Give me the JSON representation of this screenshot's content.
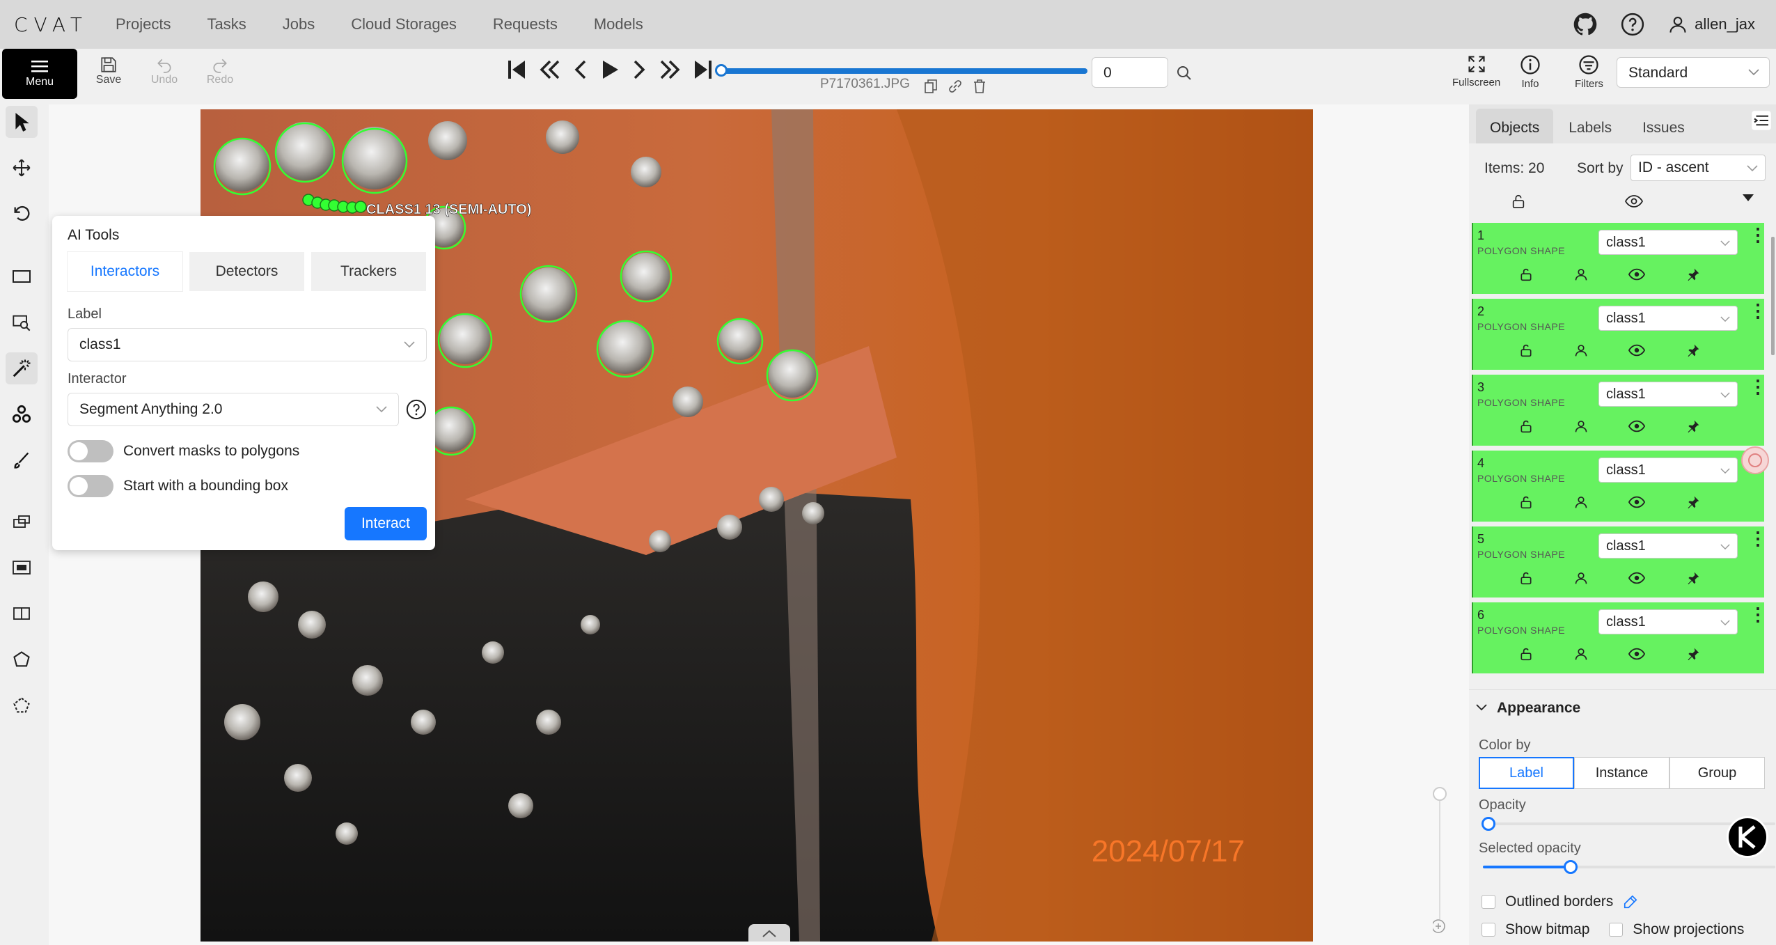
{
  "app": {
    "logo": "CVAT",
    "user": "allen_jax"
  },
  "nav": [
    "Projects",
    "Tasks",
    "Jobs",
    "Cloud Storages",
    "Requests",
    "Models"
  ],
  "toolbar": {
    "menu": "Menu",
    "save": "Save",
    "undo": "Undo",
    "redo": "Redo",
    "frame": "0",
    "filename": "P7170361.JPG",
    "fullscreen": "Fullscreen",
    "info": "Info",
    "filters": "Filters",
    "workspace": "Standard"
  },
  "canvas": {
    "shape_label": "CLASS1 13 (SEMI-AUTO)",
    "timestamp": "2024/07/17"
  },
  "ai_tools": {
    "title": "AI Tools",
    "tabs": [
      "Interactors",
      "Detectors",
      "Trackers"
    ],
    "label_title": "Label",
    "label_value": "class1",
    "interactor_title": "Interactor",
    "interactor_value": "Segment Anything 2.0",
    "toggle1": "Convert masks to polygons",
    "toggle2": "Start with a bounding box",
    "interact": "Interact"
  },
  "sidebar": {
    "tabs": [
      "Objects",
      "Labels",
      "Issues"
    ],
    "items": "Items: 20",
    "sortby": "Sort by",
    "sort_value": "ID - ascent"
  },
  "objects": [
    {
      "id": "1",
      "type": "POLYGON SHAPE",
      "label": "class1"
    },
    {
      "id": "2",
      "type": "POLYGON SHAPE",
      "label": "class1"
    },
    {
      "id": "3",
      "type": "POLYGON SHAPE",
      "label": "class1"
    },
    {
      "id": "4",
      "type": "POLYGON SHAPE",
      "label": "class1"
    },
    {
      "id": "5",
      "type": "POLYGON SHAPE",
      "label": "class1"
    },
    {
      "id": "6",
      "type": "POLYGON SHAPE",
      "label": "class1"
    }
  ],
  "appearance": {
    "title": "Appearance",
    "color_by": "Color by",
    "color_options": [
      "Label",
      "Instance",
      "Group"
    ],
    "opacity": "Opacity",
    "opacity_value": 0.02,
    "selected_opacity": "Selected opacity",
    "selected_opacity_value": 0.3,
    "outlined": "Outlined borders",
    "show_bitmap": "Show bitmap",
    "show_projections": "Show projections"
  },
  "colors": {
    "accent": "#1677ff",
    "object_bg": "#66f260",
    "polygon": "#33ff33"
  }
}
